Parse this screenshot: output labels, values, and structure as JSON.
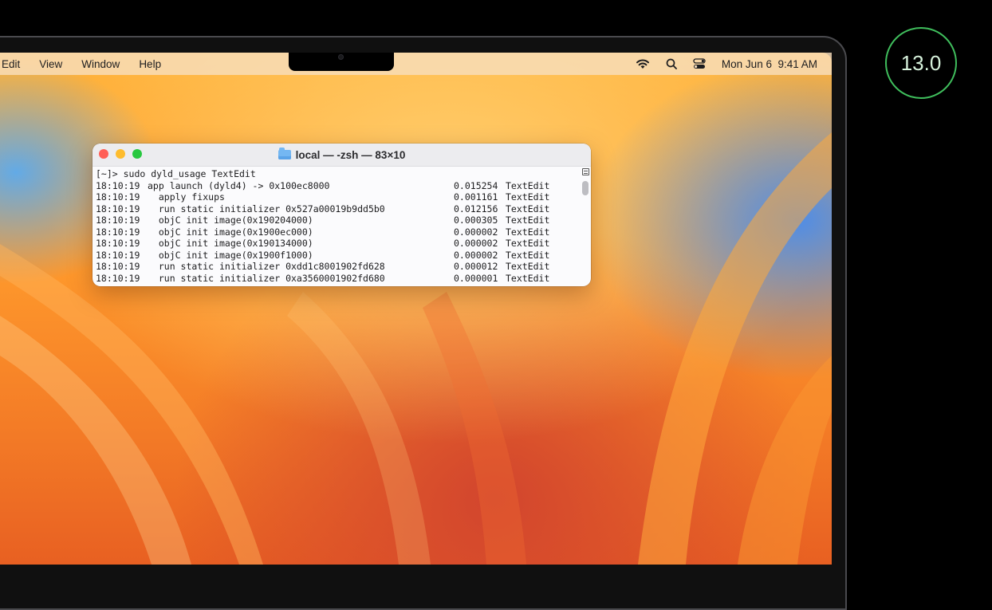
{
  "menubar": {
    "items": [
      "Edit",
      "View",
      "Window",
      "Help"
    ],
    "clock": "Mon Jun 6  9:41 AM"
  },
  "badge": {
    "label": "13.0",
    "color": "#3fbd5c"
  },
  "terminal": {
    "title": "local — -zsh — 83×10",
    "prompt": "[~]> sudo dyld_usage TextEdit",
    "lines": [
      {
        "time": "18:10:19",
        "desc": "app launch (dyld4) -> 0x100ec8000",
        "dur": "0.015254",
        "proc": "TextEdit"
      },
      {
        "time": "18:10:19",
        "desc": "  apply fixups",
        "dur": "0.001161",
        "proc": "TextEdit"
      },
      {
        "time": "18:10:19",
        "desc": "  run static initializer 0x527a00019b9dd5b0",
        "dur": "0.012156",
        "proc": "TextEdit"
      },
      {
        "time": "18:10:19",
        "desc": "  objC init image(0x190204000)",
        "dur": "0.000305",
        "proc": "TextEdit"
      },
      {
        "time": "18:10:19",
        "desc": "  objC init image(0x1900ec000)",
        "dur": "0.000002",
        "proc": "TextEdit"
      },
      {
        "time": "18:10:19",
        "desc": "  objC init image(0x190134000)",
        "dur": "0.000002",
        "proc": "TextEdit"
      },
      {
        "time": "18:10:19",
        "desc": "  objC init image(0x1900f1000)",
        "dur": "0.000002",
        "proc": "TextEdit"
      },
      {
        "time": "18:10:19",
        "desc": "  run static initializer 0xdd1c8001902fd628",
        "dur": "0.000012",
        "proc": "TextEdit"
      },
      {
        "time": "18:10:19",
        "desc": "  run static initializer 0xa3560001902fd680",
        "dur": "0.000001",
        "proc": "TextEdit"
      }
    ]
  },
  "icons": [
    "wifi-icon",
    "search-icon",
    "control-center-icon",
    "folder-icon"
  ]
}
